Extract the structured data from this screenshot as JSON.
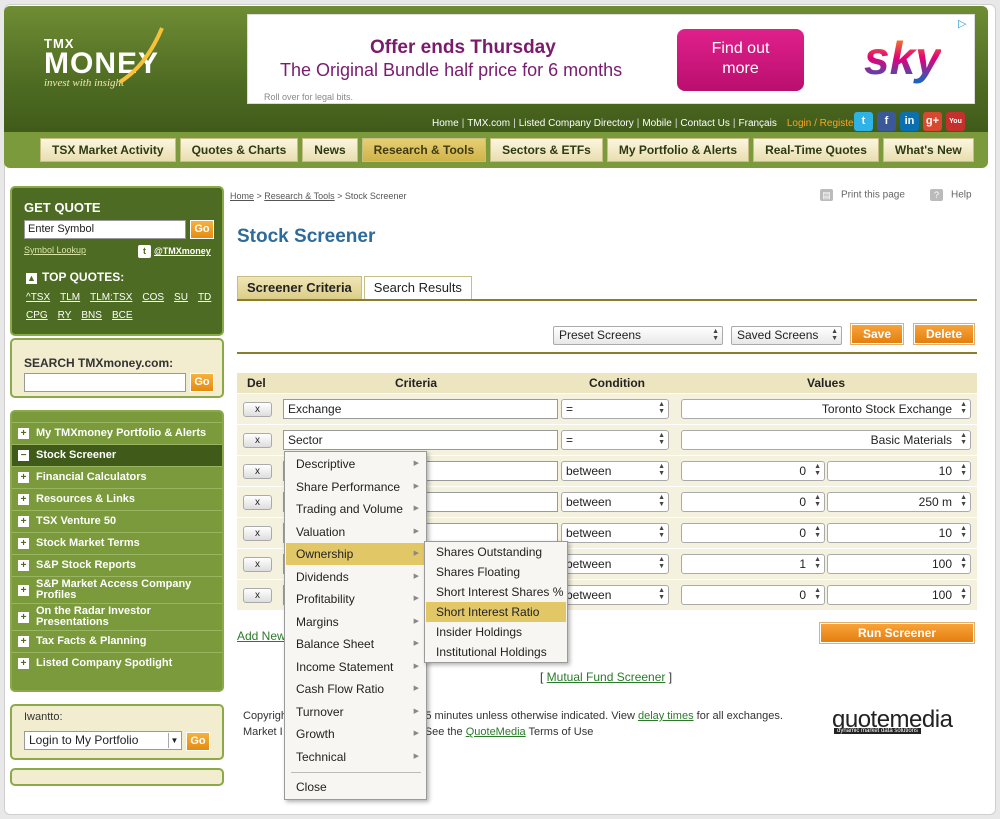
{
  "brand": {
    "tmx": "TMX",
    "money": "MONEY",
    "tagline": "invest with insight"
  },
  "ad": {
    "line1": "Offer ends Thursday",
    "line2": "The Original Bundle half price for 6 months",
    "legal": "Roll over for legal bits.",
    "cta_line1": "Find out",
    "cta_line2": "more",
    "brand": "sky"
  },
  "toplinks": {
    "items": [
      "Home",
      "TMX.com",
      "Listed Company Directory",
      "Mobile",
      "Contact Us",
      "Français"
    ],
    "login": "Login / Register"
  },
  "social": [
    "t",
    "f",
    "in",
    "g+",
    "You"
  ],
  "nav": [
    "TSX Market Activity",
    "Quotes & Charts",
    "News",
    "Research & Tools",
    "Sectors & ETFs",
    "My Portfolio & Alerts",
    "Real-Time Quotes",
    "What's New"
  ],
  "nav_active": "Research & Tools",
  "getquote": {
    "title": "GET QUOTE",
    "placeholder": "Enter Symbol",
    "go": "Go",
    "lookup": "Symbol Lookup",
    "twitter": "@TMXmoney",
    "top_quotes_title": "TOP QUOTES:",
    "top_quotes": [
      "^TSX",
      "TLM",
      "TLM:TSX",
      "COS",
      "SU",
      "TD",
      "CPG",
      "RY",
      "BNS",
      "BCE"
    ]
  },
  "search": {
    "title": "SEARCH TMXmoney.com:",
    "go": "Go"
  },
  "menu": [
    {
      "label": "My TMXmoney Portfolio & Alerts",
      "sign": "+"
    },
    {
      "label": "Stock Screener",
      "sign": "−"
    },
    {
      "label": "Financial Calculators",
      "sign": "+"
    },
    {
      "label": "Resources & Links",
      "sign": "+"
    },
    {
      "label": "TSX Venture 50",
      "sign": "+"
    },
    {
      "label": "Stock Market Terms",
      "sign": "+"
    },
    {
      "label": "S&P Stock Reports",
      "sign": "+"
    },
    {
      "label": "S&P Market Access Company Profiles",
      "sign": "+"
    },
    {
      "label": "On the Radar Investor Presentations",
      "sign": "+"
    },
    {
      "label": "Tax Facts & Planning",
      "sign": "+"
    },
    {
      "label": "Listed Company Spotlight",
      "sign": "+"
    }
  ],
  "iwant": {
    "title": "Iwantto:",
    "selected": "Login to My Portfolio",
    "go": "Go"
  },
  "breadcrumb": {
    "home": "Home",
    "section": "Research & Tools",
    "current": "Stock Screener"
  },
  "print": "Print this page",
  "help": "Help",
  "page_title": "Stock Screener",
  "tabs": [
    "Screener Criteria",
    "Search Results"
  ],
  "preset": "Preset Screens",
  "saved": "Saved Screens",
  "save_btn": "Save",
  "delete_btn": "Delete",
  "grid": {
    "headers": {
      "del": "Del",
      "criteria": "Criteria",
      "condition": "Condition",
      "values": "Values"
    },
    "rows": [
      {
        "criteria": "Exchange",
        "condition": "=",
        "value": "Toronto Stock Exchange"
      },
      {
        "criteria": "Sector",
        "condition": "=",
        "value": "Basic Materials"
      },
      {
        "criteria": "",
        "condition": "between",
        "min": "0",
        "max": "10"
      },
      {
        "criteria": "",
        "condition": "between",
        "min": "0",
        "max": "250 m"
      },
      {
        "criteria": "",
        "condition": "between",
        "min": "0",
        "max": "10"
      },
      {
        "criteria": "",
        "condition": "between",
        "min": "1",
        "max": "100"
      },
      {
        "criteria": "",
        "condition": "between",
        "min": "0",
        "max": "100"
      }
    ],
    "del_label": "x"
  },
  "add_new": "Add New",
  "run": "Run Screener",
  "mutual_fund": "Mutual Fund Screener",
  "footer": {
    "a": "Copyright",
    "b": "d 15 minutes unless otherwise indicated. View",
    "delay": "delay times",
    "c": "for all exchanges.",
    "d": "Market I",
    "e": "See the",
    "qm": "QuoteMedia",
    "f": "Terms of Use"
  },
  "quotemedia": {
    "name": "quotemedia",
    "sub": "dynamic market data solutions"
  },
  "popup": {
    "items": [
      "Descriptive",
      "Share Performance",
      "Trading and Volume",
      "Valuation",
      "Ownership",
      "Dividends",
      "Profitability",
      "Margins",
      "Balance Sheet",
      "Income Statement",
      "Cash Flow Ratio",
      "Turnover",
      "Growth",
      "Technical"
    ],
    "selected": "Ownership",
    "close": "Close"
  },
  "submenu": {
    "items": [
      "Shares Outstanding",
      "Shares Floating",
      "Short Interest Shares %",
      "Short Interest Ratio",
      "Insider Holdings",
      "Institutional Holdings"
    ],
    "selected": "Short Interest Ratio"
  },
  "colors": {
    "brand_green": "#4d6b22",
    "accent_orange": "#f09a25",
    "title_blue": "#2d6b9c",
    "highlight": "#e2c766"
  }
}
